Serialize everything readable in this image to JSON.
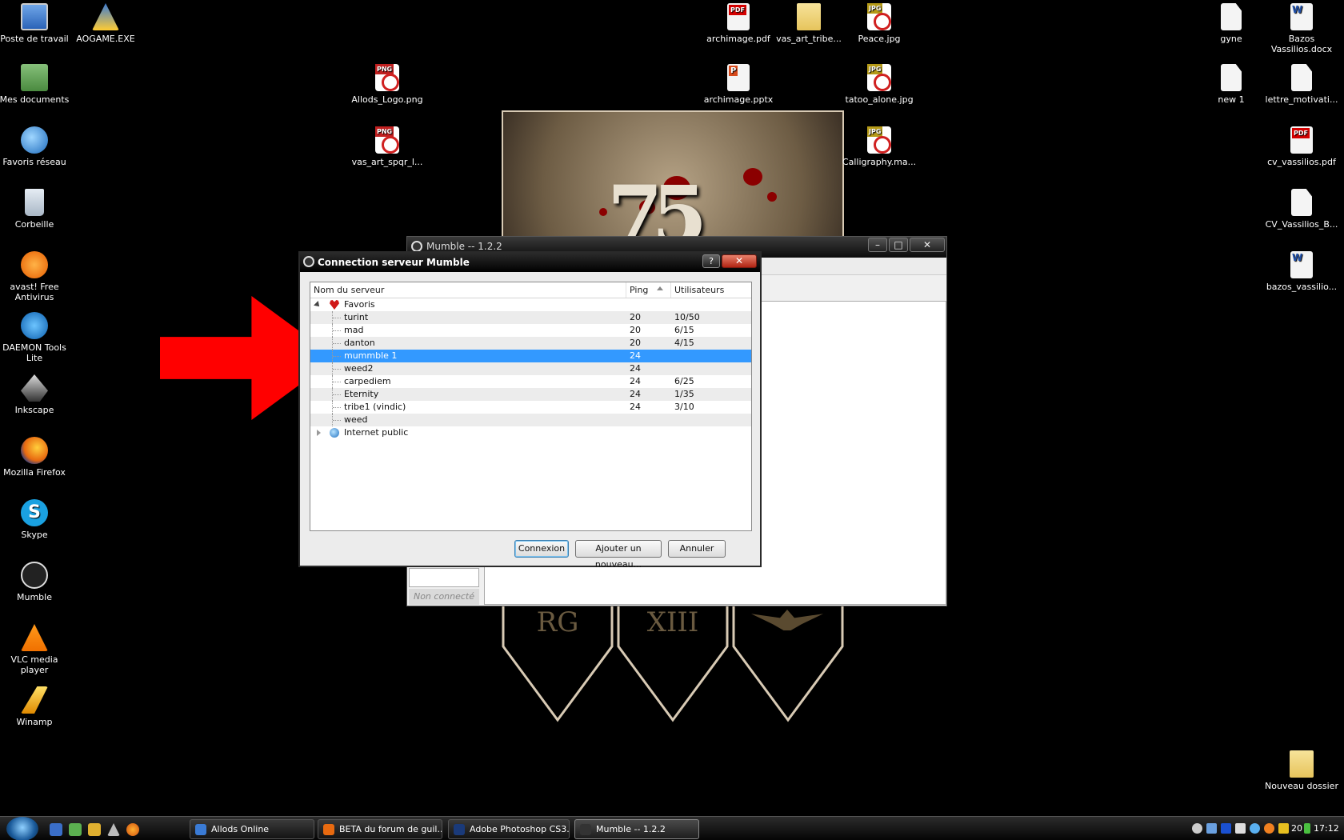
{
  "desktop": {
    "left_icons": [
      {
        "label": "Poste de travail",
        "icon": "computer-icon",
        "kind": "computer"
      },
      {
        "label": "Mes documents",
        "icon": "documents-icon",
        "kind": "docs"
      },
      {
        "label": "Favoris réseau",
        "icon": "network-icon",
        "kind": "net"
      },
      {
        "label": "Corbeille",
        "icon": "recycle-bin-icon",
        "kind": "trash"
      },
      {
        "label": "avast! Free Antivirus",
        "icon": "avast-icon",
        "kind": "avast"
      },
      {
        "label": "DAEMON Tools Lite",
        "icon": "daemon-tools-icon",
        "kind": "daemon"
      },
      {
        "label": "Inkscape",
        "icon": "inkscape-icon",
        "kind": "ink"
      },
      {
        "label": "Mozilla Firefox",
        "icon": "firefox-icon",
        "kind": "firefox"
      },
      {
        "label": "Skype",
        "icon": "skype-icon",
        "kind": "skype"
      },
      {
        "label": "Mumble",
        "icon": "mumble-icon",
        "kind": "mumble"
      },
      {
        "label": "VLC media player",
        "icon": "vlc-icon",
        "kind": "vlc"
      },
      {
        "label": "Winamp",
        "icon": "winamp-icon",
        "kind": "winamp"
      }
    ],
    "aogame": {
      "label": "AOGAME.EXE",
      "icon": "aogame-icon"
    },
    "allods_logo": {
      "label": "Allods_Logo.png",
      "icon": "png-file-icon"
    },
    "vas_art_spqr": {
      "label": "vas_art_spqr_l...",
      "icon": "png-file-icon"
    },
    "archimage_pdf": {
      "label": "archimage.pdf",
      "icon": "pdf-file-icon"
    },
    "vas_art_tribe": {
      "label": "vas_art_tribe...",
      "icon": "folder-icon"
    },
    "peace_jpg": {
      "label": "Peace.jpg",
      "icon": "jpg-file-icon"
    },
    "archimage_pptx": {
      "label": "archimage.pptx",
      "icon": "pptx-file-icon"
    },
    "tatoo_alone": {
      "label": "tatoo_alone.jpg",
      "icon": "jpg-file-icon"
    },
    "calligraphy": {
      "label": "Calligraphy.ma...",
      "icon": "jpg-file-icon"
    },
    "gyne": {
      "label": "gyne",
      "icon": "file-icon"
    },
    "bazos_docx": {
      "label": "Bazos Vassilios.docx",
      "icon": "docx-file-icon"
    },
    "new1": {
      "label": "new 1",
      "icon": "file-icon"
    },
    "lettre": {
      "label": "lettre_motivati...",
      "icon": "file-icon"
    },
    "cv_pdf": {
      "label": "cv_vassilios.pdf",
      "icon": "pdf-file-icon"
    },
    "cv_b": {
      "label": "CV_Vassilios_B...",
      "icon": "file-icon"
    },
    "bazos_vassilio": {
      "label": "bazos_vassilio...",
      "icon": "docx-file-icon"
    },
    "nouveau_dossier": {
      "label": "Nouveau dossier",
      "icon": "folder-icon"
    }
  },
  "wallpaper": {
    "numeral": "75",
    "banners": [
      "RG",
      "XIII",
      ""
    ]
  },
  "mumble_main": {
    "title": "Mumble -- 1.2.2",
    "status": "Non connecté",
    "minimize": "–",
    "maximize": "□",
    "close": "✕"
  },
  "dialog": {
    "title": "Connection serveur Mumble",
    "help": "?",
    "close": "✕",
    "columns": {
      "name": "Nom du serveur",
      "ping": "Ping",
      "users": "Utilisateurs"
    },
    "favorites_label": "Favoris",
    "public_label": "Internet public",
    "servers": [
      {
        "name": "turint",
        "ping": "20",
        "users": "10/50"
      },
      {
        "name": "mad",
        "ping": "20",
        "users": "6/15"
      },
      {
        "name": "danton",
        "ping": "20",
        "users": "4/15"
      },
      {
        "name": "mummble 1",
        "ping": "24",
        "users": ""
      },
      {
        "name": "weed2",
        "ping": "24",
        "users": ""
      },
      {
        "name": "carpediem",
        "ping": "24",
        "users": "6/25"
      },
      {
        "name": "Eternity",
        "ping": "24",
        "users": "1/35"
      },
      {
        "name": "tribe1 (vindic)",
        "ping": "24",
        "users": "3/10"
      },
      {
        "name": "weed",
        "ping": "",
        "users": ""
      }
    ],
    "selected_index": 3,
    "buttons": {
      "connect": "Connexion",
      "add": "Ajouter un nouveau...",
      "cancel": "Annuler"
    }
  },
  "taskbar": {
    "tasks": [
      {
        "label": "Allods Online",
        "icon": "aogame-icon"
      },
      {
        "label": "BETA du forum de guil...",
        "icon": "firefox-icon"
      },
      {
        "label": "Adobe Photoshop CS3...",
        "icon": "photoshop-icon"
      },
      {
        "label": "Mumble -- 1.2.2",
        "icon": "mumble-icon"
      }
    ],
    "clock": "17:12",
    "tray_temp": "20"
  },
  "colors": {
    "selection": "#3399ff",
    "arrow": "#ff0000"
  }
}
